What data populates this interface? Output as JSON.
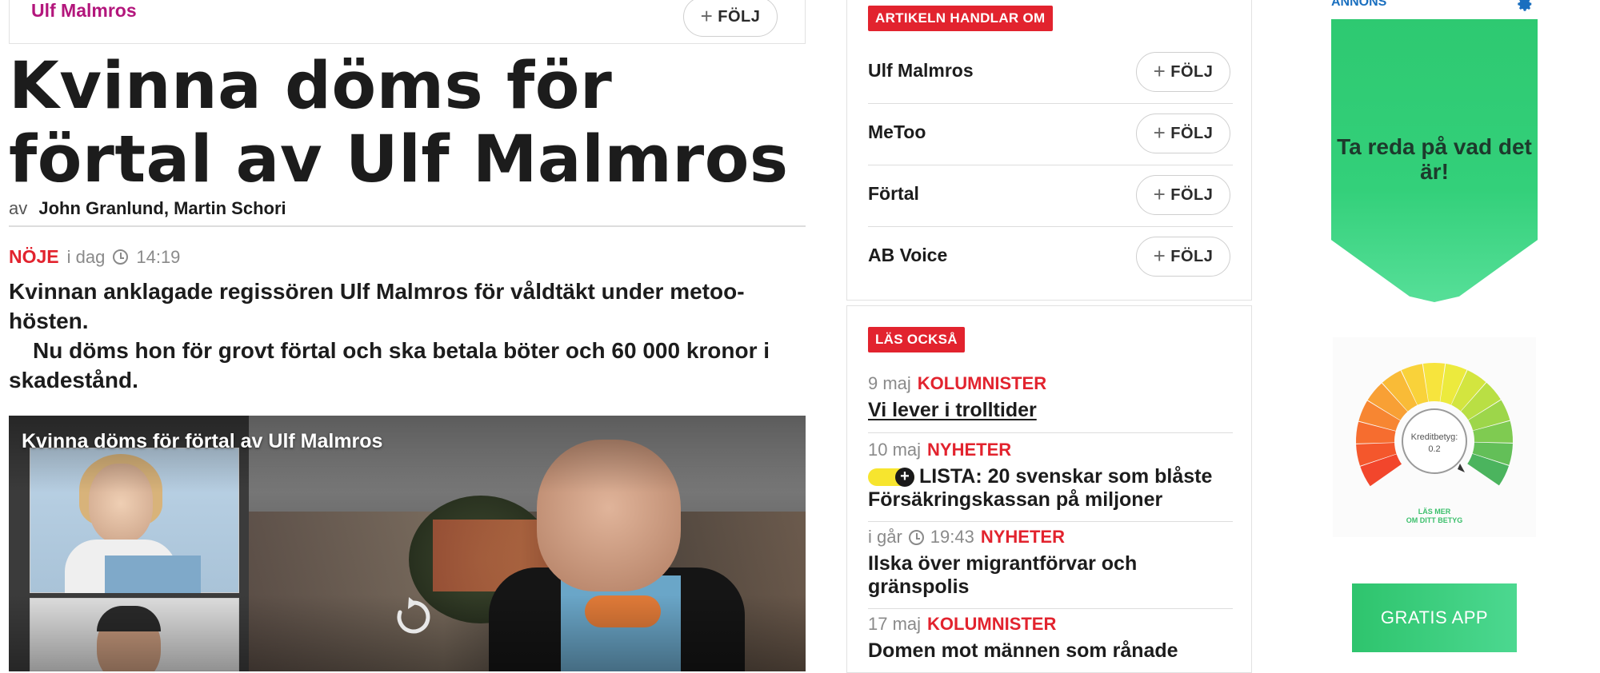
{
  "topic_bar": {
    "name": "Ulf Malmros",
    "follow_label": "FÖLJ"
  },
  "article": {
    "headline": "Kvinna döms för förtal av Ulf Malmros",
    "byline_prefix": "av",
    "authors": [
      "John Granlund,",
      "Martin Schori"
    ],
    "category": "NÖJE",
    "day": "i dag",
    "time": "14:19",
    "lead_1": "Kvinnan anklagade regissören Ulf Malmros för våldtäkt under metoo-hösten.",
    "lead_2": "Nu döms hon för grovt förtal och ska betala böter och 60 000 kronor i skadestånd."
  },
  "video": {
    "title": "Kvinna döms för förtal av Ulf Malmros"
  },
  "about": {
    "heading": "ARTIKELN HANDLAR OM",
    "follow_label": "FÖLJ",
    "tags": [
      "Ulf Malmros",
      "MeToo",
      "Förtal",
      "AB Voice"
    ]
  },
  "also_read": {
    "heading": "LÄS OCKSÅ",
    "items": [
      {
        "date": "9 maj",
        "category": "KOLUMNISTER",
        "title": "Vi lever i trolltider"
      },
      {
        "date": "10 maj",
        "category": "NYHETER",
        "title": "LISTA: 20 svenskar som blåste Försäkringskassan på miljoner"
      },
      {
        "date": "i går",
        "time": "19:43",
        "category": "NYHETER",
        "title": "Ilska över migrantförvar och gränspolis"
      },
      {
        "date": "17 maj",
        "category": "KOLUMNISTER",
        "title": "Domen mot männen som rånade"
      }
    ]
  },
  "ad": {
    "label": "ANNONS",
    "shield_text": "Ta reda på vad det är!",
    "gauge_label": "Kreditbetyg:",
    "gauge_value": "0.2",
    "gauge_cta": "LÄS MER",
    "gauge_cta_2": "OM DITT BETYG",
    "app_button": "GRATIS APP"
  },
  "colors": {
    "accent_red": "#e2232e",
    "topic_magenta": "#b3167c",
    "ad_green": "#2ec971",
    "plus_yellow": "#f7e52e"
  },
  "icons": [
    "plus-icon",
    "clock-icon",
    "replay-icon",
    "gear-icon"
  ]
}
